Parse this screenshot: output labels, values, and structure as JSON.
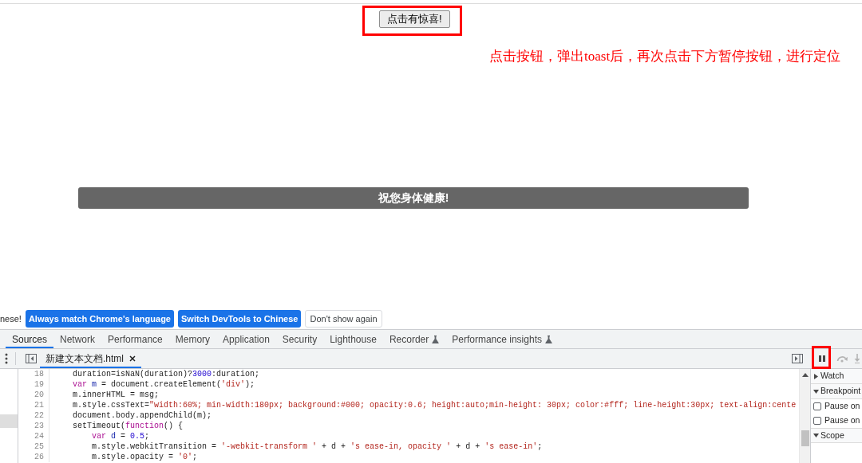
{
  "page": {
    "button": {
      "label": "点击有惊喜!",
      "highlighted": true
    },
    "annotation": "点击按钮，弹出toast后，再次点击下方暂停按钮，进行定位",
    "toast": "祝您身体健康!"
  },
  "devtools": {
    "infobar": {
      "message": "nese!",
      "buttons": [
        {
          "label": "Always match Chrome's language",
          "kind": "primary"
        },
        {
          "label": "Switch DevTools to Chinese",
          "kind": "primary"
        },
        {
          "label": "Don't show again",
          "kind": "secondary"
        }
      ]
    },
    "tabs": [
      {
        "label": "Sources",
        "selected": true,
        "experimental": false
      },
      {
        "label": "Network",
        "selected": false,
        "experimental": false
      },
      {
        "label": "Performance",
        "selected": false,
        "experimental": false
      },
      {
        "label": "Memory",
        "selected": false,
        "experimental": false
      },
      {
        "label": "Application",
        "selected": false,
        "experimental": false
      },
      {
        "label": "Security",
        "selected": false,
        "experimental": false
      },
      {
        "label": "Lighthouse",
        "selected": false,
        "experimental": false
      },
      {
        "label": "Recorder",
        "selected": false,
        "experimental": true
      },
      {
        "label": "Performance insights",
        "selected": false,
        "experimental": true
      }
    ],
    "editor_tabs": [
      {
        "label": "新建文本文档.html",
        "selected": true
      }
    ],
    "debugger_controls": [
      {
        "kind": "pause",
        "highlighted": true,
        "disabled": false
      },
      {
        "kind": "step_over",
        "highlighted": false,
        "disabled": true
      },
      {
        "kind": "step_into",
        "highlighted": false,
        "disabled": true
      }
    ],
    "code_lines": [
      {
        "number": "18",
        "tokens": [
          {
            "text": "    duration=isNaN(duration)?",
            "kind": "plain"
          },
          {
            "text": "3000",
            "kind": "number"
          },
          {
            "text": ":duration;",
            "kind": "plain"
          }
        ]
      },
      {
        "number": "19",
        "tokens": [
          {
            "text": "    var",
            "kind": "keyword"
          },
          {
            "text": " m",
            "kind": "def"
          },
          {
            "text": " = document.createElement(",
            "kind": "plain"
          },
          {
            "text": "'div'",
            "kind": "string"
          },
          {
            "text": ");",
            "kind": "plain"
          }
        ]
      },
      {
        "number": "20",
        "tokens": [
          {
            "text": "    m.innerHTML = msg;",
            "kind": "plain"
          }
        ]
      },
      {
        "number": "21",
        "tokens": [
          {
            "text": "    m.style.cssText=",
            "kind": "plain"
          },
          {
            "text": "\"width:60%; min-width:180px; background:#000; opacity:0.6; height:auto;min-height: 30px; color:#fff; line-height:30px; text-align:cente",
            "kind": "string"
          }
        ]
      },
      {
        "number": "22",
        "tokens": [
          {
            "text": "    document.body.appendChild(m);",
            "kind": "plain"
          }
        ]
      },
      {
        "number": "23",
        "tokens": [
          {
            "text": "    setTimeout(",
            "kind": "plain"
          },
          {
            "text": "function",
            "kind": "keyword"
          },
          {
            "text": "() {",
            "kind": "plain"
          }
        ]
      },
      {
        "number": "24",
        "tokens": [
          {
            "text": "        var",
            "kind": "keyword"
          },
          {
            "text": " d",
            "kind": "def"
          },
          {
            "text": " = ",
            "kind": "plain"
          },
          {
            "text": "0.5",
            "kind": "number"
          },
          {
            "text": ";",
            "kind": "plain"
          }
        ]
      },
      {
        "number": "25",
        "tokens": [
          {
            "text": "        m.style.webkitTransition = ",
            "kind": "plain"
          },
          {
            "text": "'-webkit-transform '",
            "kind": "string"
          },
          {
            "text": " + d + ",
            "kind": "plain"
          },
          {
            "text": "'s ease-in, opacity '",
            "kind": "string"
          },
          {
            "text": " + d + ",
            "kind": "plain"
          },
          {
            "text": "'s ease-in'",
            "kind": "string"
          },
          {
            "text": ";",
            "kind": "plain"
          }
        ]
      },
      {
        "number": "26",
        "tokens": [
          {
            "text": "        m.style.opacity = ",
            "kind": "plain"
          },
          {
            "text": "'0'",
            "kind": "string"
          },
          {
            "text": ";",
            "kind": "plain"
          }
        ]
      }
    ],
    "sidebar": [
      {
        "kind": "section",
        "label": "Watch",
        "expanded": false
      },
      {
        "kind": "section",
        "label": "Breakpoint",
        "expanded": true
      },
      {
        "kind": "checkbox",
        "label": "Pause on",
        "checked": false
      },
      {
        "kind": "checkbox",
        "label": "Pause on",
        "checked": false
      },
      {
        "kind": "section",
        "label": "Scope",
        "expanded": true
      }
    ]
  }
}
